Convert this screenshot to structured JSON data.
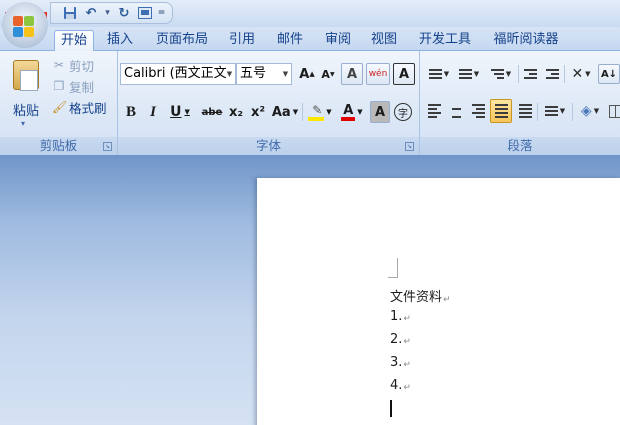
{
  "quick_access": {
    "undo_dropdown": "▾",
    "customize": "="
  },
  "tabs": [
    {
      "label": "开始",
      "active": true
    },
    {
      "label": "插入"
    },
    {
      "label": "页面布局"
    },
    {
      "label": "引用"
    },
    {
      "label": "邮件"
    },
    {
      "label": "审阅"
    },
    {
      "label": "视图"
    },
    {
      "label": "开发工具"
    },
    {
      "label": "福昕阅读器"
    }
  ],
  "clipboard": {
    "paste_label": "粘贴",
    "cut_label": "剪切",
    "copy_label": "复制",
    "format_painter_label": "格式刷",
    "group_label": "剪贴板"
  },
  "font": {
    "font_name": "Calibri (西文正文",
    "font_size": "五号",
    "grow_label": "A",
    "shrink_label": "A",
    "clear_format_label": "A",
    "phonetic_label": "wén",
    "border_char_label": "A",
    "bold": "B",
    "italic": "I",
    "underline": "U",
    "strikethrough": "abe",
    "subscript": "x₂",
    "superscript": "x²",
    "change_case": "Aa",
    "font_color": "A",
    "char_shading": "A",
    "enclose": "字",
    "group_label": "字体"
  },
  "paragraph": {
    "group_label": "段落",
    "sort_label": "A↓"
  },
  "document": {
    "lines": [
      "文件资料",
      "1.",
      "2.",
      "3.",
      "4."
    ]
  },
  "colors": {
    "accent": "#15428b",
    "highlight": "#ffe800",
    "font_color": "#e00000",
    "office_button_frame": "#e0312a"
  }
}
